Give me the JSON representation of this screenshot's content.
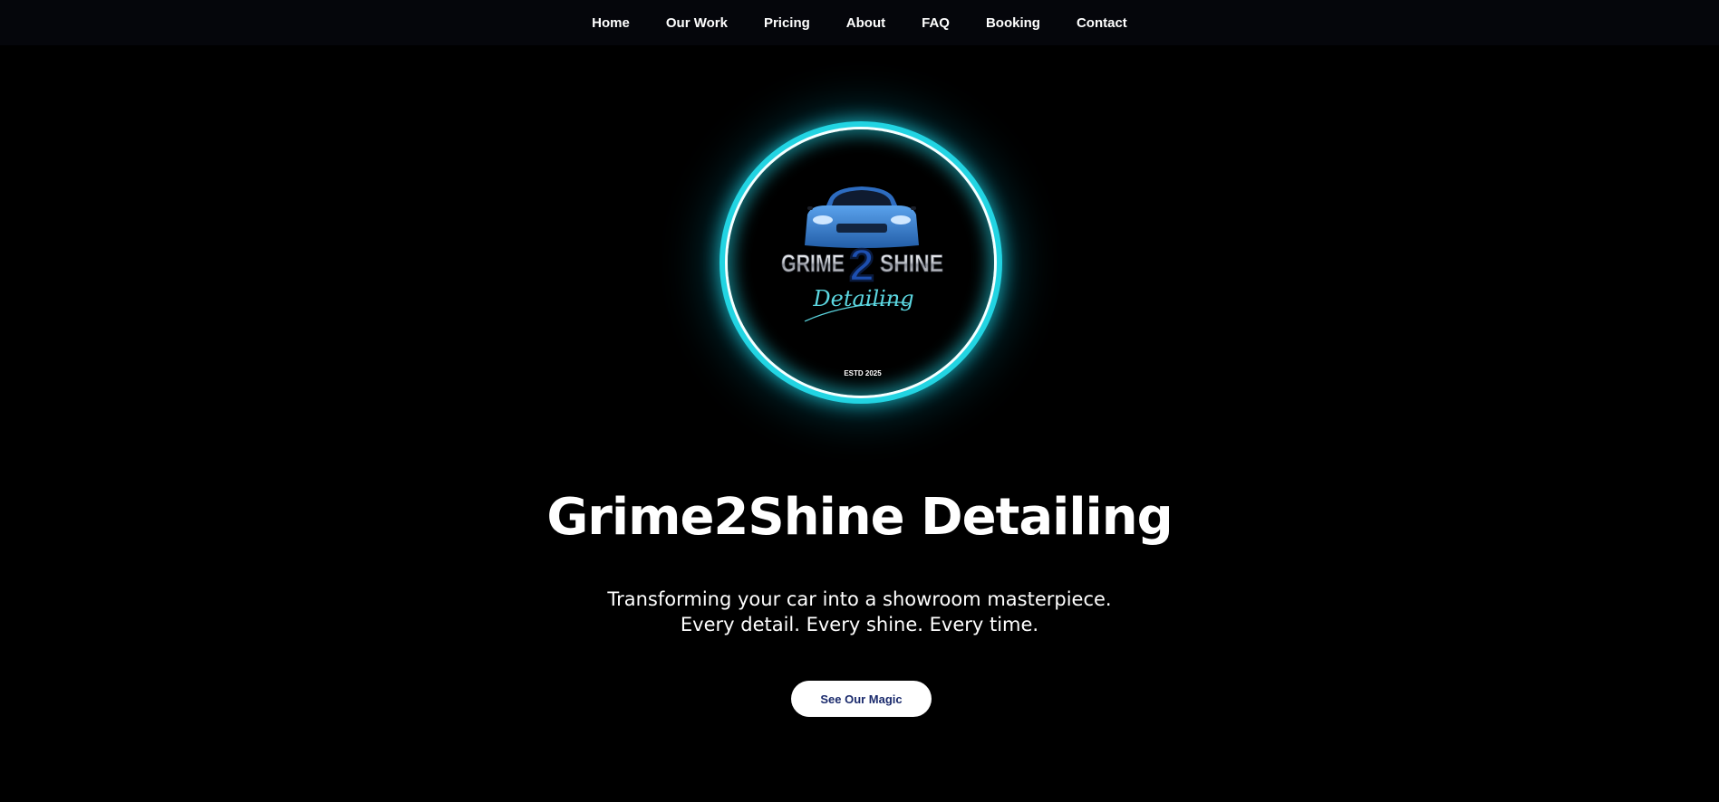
{
  "nav": {
    "items": [
      "Home",
      "Our Work",
      "Pricing",
      "About",
      "FAQ",
      "Booking",
      "Contact"
    ]
  },
  "logo": {
    "brand_line": "GRIME",
    "brand_number": "2",
    "brand_line_end": "SHINE",
    "script_text": "Detailing",
    "established": "ESTD 2025"
  },
  "hero": {
    "title": "Grime2Shine Detailing",
    "subtitle_line1": "Transforming your car into a showroom masterpiece.",
    "subtitle_line2": "Every detail. Every shine. Every time.",
    "cta_label": "See Our Magic"
  },
  "colors": {
    "background": "#000000",
    "nav_background": "#05060b",
    "ring_glow": "#22d4e2",
    "car_blue": "#3a7fd6",
    "cta_text": "#1a2a6c"
  }
}
